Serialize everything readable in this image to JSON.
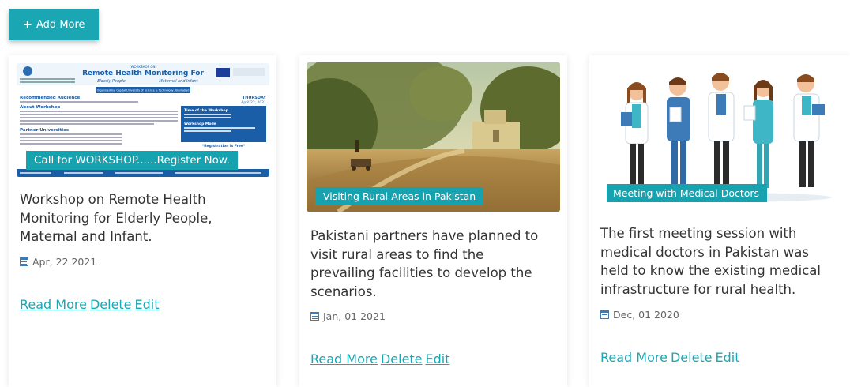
{
  "toolbar": {
    "add_more_label": "Add More"
  },
  "posters": {
    "workshop": {
      "header_small": "WORKSHOP ON",
      "header_big": "Remote Health Monitoring For",
      "sub_left": "Elderly People",
      "sub_right": "Maternal and Infant",
      "organized_by": "Organized by: Capital University of Science & Technology, Islamabad",
      "recommended_audience": "Recommended Audience",
      "about": "About Workshop",
      "partner_unis": "Partner Universities",
      "date_day": "THURSDAY",
      "date_text": "April 22, 2021",
      "time_heading": "Time of the Workshop",
      "mode_heading": "Workshop Mode",
      "free": "*Registration is Free*"
    }
  },
  "cards": [
    {
      "badge": "Call for WORKSHOP......Register Now.",
      "title_lines": [
        "Workshop on Remote Health",
        "Monitoring for Elderly People,",
        "Maternal and Infant."
      ],
      "date": "Apr, 22 2021",
      "read_more": "Read More",
      "delete": "Delete",
      "edit": "Edit"
    },
    {
      "badge": "Visiting Rural Areas in Pakistan",
      "title_lines": [
        "Pakistani partners have planned to",
        "visit rural areas to find the",
        "prevailing facilities to develop the",
        "scenarios."
      ],
      "date": "Jan, 01 2021",
      "read_more": "Read More",
      "delete": "Delete",
      "edit": "Edit"
    },
    {
      "badge": "Meeting with Medical Doctors",
      "title_lines": [
        "The first meeting session with",
        "medical doctors in Pakistan was",
        "held to know the existing medical",
        "infrastructure for rural health."
      ],
      "date": "Dec, 01 2020",
      "read_more": "Read More",
      "delete": "Delete",
      "edit": "Edit"
    }
  ],
  "colors": {
    "accent": "#1aa6b3",
    "badge": "#17a2b0",
    "text": "#333333"
  }
}
